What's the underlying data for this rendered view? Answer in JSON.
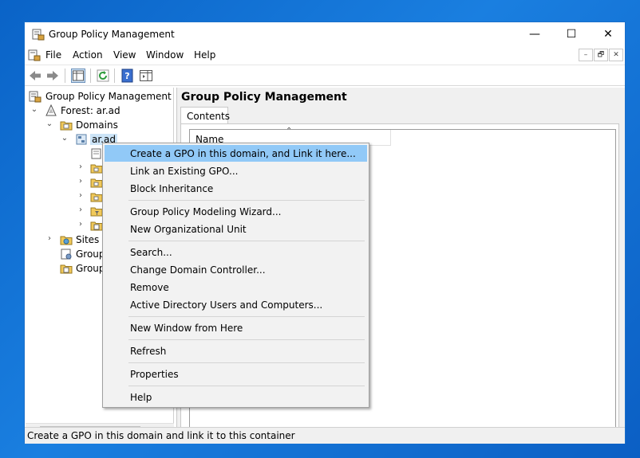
{
  "window": {
    "title": "Group Policy Management",
    "controls": {
      "minimize": "—",
      "maximize": "☐",
      "close": "✕"
    }
  },
  "menubar": {
    "items": [
      "File",
      "Action",
      "View",
      "Window",
      "Help"
    ],
    "mdi": {
      "minimize": "–",
      "restore": "🗗",
      "close": "✕"
    }
  },
  "toolbar": {
    "buttons": [
      "back-arrow-icon",
      "forward-arrow-icon",
      "show-hide-console-tree-icon",
      "refresh-icon",
      "help-icon",
      "action-pane-icon"
    ]
  },
  "tree": {
    "items": [
      {
        "label": "Group Policy Management",
        "icon": "gpmc-icon",
        "expander": ""
      },
      {
        "label": "Forest: ar.ad",
        "icon": "forest-icon",
        "expander": "⌄"
      },
      {
        "label": "Domains",
        "icon": "folder-icon",
        "expander": "⌄"
      },
      {
        "label": "ar.ad",
        "icon": "domain-icon",
        "expander": "⌄"
      },
      {
        "label": "",
        "icon": "gpo-link-icon",
        "expander": ""
      },
      {
        "label": "",
        "icon": "ou-icon",
        "expander": "›"
      },
      {
        "label": "",
        "icon": "ou-icon",
        "expander": "›"
      },
      {
        "label": "",
        "icon": "ou-icon",
        "expander": "›"
      },
      {
        "label": "",
        "icon": "wmi-filters-icon",
        "expander": "›"
      },
      {
        "label": "",
        "icon": "starter-gpo-icon",
        "expander": "›"
      },
      {
        "label": "Sites",
        "icon": "sites-icon",
        "expander": "›"
      },
      {
        "label": "Group",
        "icon": "modeling-icon",
        "expander": ""
      },
      {
        "label": "Group",
        "icon": "results-icon",
        "expander": ""
      }
    ],
    "scroll_left": "‹",
    "scroll_right": "›"
  },
  "right_pane": {
    "title": "Group Policy Management",
    "tab": "Contents",
    "column_header": "Name",
    "sort_indicator": "⌃"
  },
  "context_menu": {
    "items": [
      "Create a GPO in this domain, and Link it here...",
      "Link an Existing GPO...",
      "Block Inheritance",
      "Group Policy Modeling Wizard...",
      "New Organizational Unit",
      "Search...",
      "Change Domain Controller...",
      "Remove",
      "Active Directory Users and Computers...",
      "New Window from Here",
      "Refresh",
      "Properties",
      "Help"
    ],
    "highlighted_index": 0
  },
  "statusbar": {
    "text": "Create a GPO in this domain and link it to this container"
  },
  "colors": {
    "desktop": "#0a63c7",
    "highlight": "#91c9f7",
    "menu_bg": "#f2f2f2"
  }
}
